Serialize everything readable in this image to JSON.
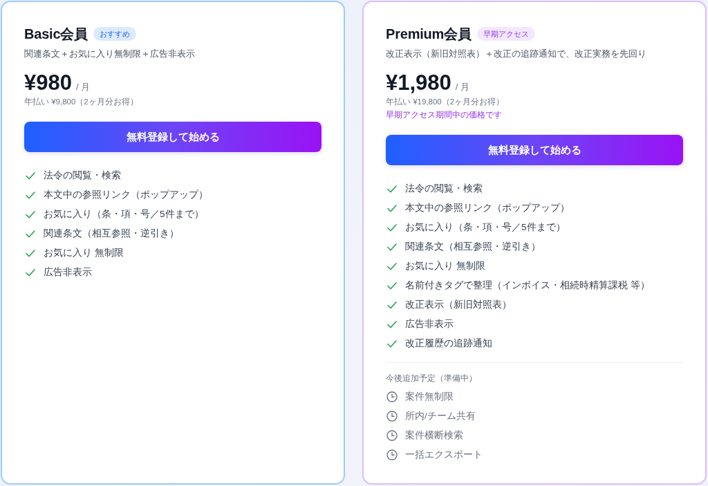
{
  "plans": [
    {
      "kind": "basic",
      "name": "Basic会員",
      "badge": "おすすめ",
      "description": "関連条文＋お気に入り無制限＋広告非表示",
      "price": "¥980",
      "period": "/ 月",
      "annual": "年払い ¥9,800（2ヶ月分お得）",
      "cta": "無料登録して始める",
      "features": [
        "法令の閲覧・検索",
        "本文中の参照リンク（ポップアップ）",
        "お気に入り（条・項・号／5件まで）",
        "関連条文（相互参照・逆引き）",
        "お気に入り 無制限",
        "広告非表示"
      ]
    },
    {
      "kind": "premium",
      "name": "Premium会員",
      "badge": "早期アクセス",
      "description": "改正表示（新旧対照表）＋改正の追跡通知で、改正実務を先回り",
      "price": "¥1,980",
      "period": "/ 月",
      "annual": "年払い ¥19,800（2ヶ月分お得）",
      "note": "早期アクセス期間中の価格です",
      "cta": "無料登録して始める",
      "features": [
        "法令の閲覧・検索",
        "本文中の参照リンク（ポップアップ）",
        "お気に入り（条・項・号／5件まで）",
        "関連条文（相互参照・逆引き）",
        "お気に入り 無制限",
        "名前付きタグで整理（インボイス・相続時精算課税 等）",
        "改正表示（新旧対照表）",
        "広告非表示",
        "改正履歴の追跡通知"
      ],
      "upcoming": {
        "heading": "今後追加予定（準備中）",
        "items": [
          "案件無制限",
          "所内/チーム共有",
          "案件横断検索",
          "一括エクスポート"
        ]
      }
    }
  ]
}
